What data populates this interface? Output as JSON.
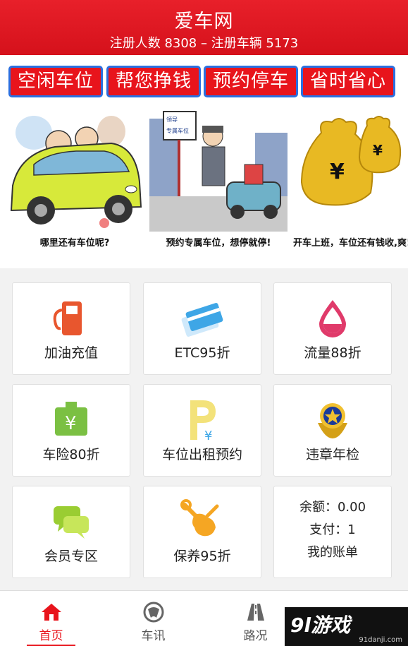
{
  "header": {
    "title": "爱车网",
    "stats": "注册人数 8308 – 注册车辆 5173"
  },
  "tags": [
    "空闲车位",
    "帮您挣钱",
    "预约停车",
    "省时省心"
  ],
  "banner": {
    "slides": [
      {
        "caption": "哪里还有车位呢?"
      },
      {
        "caption": "预约专属车位，想停就停!"
      },
      {
        "caption": "开车上班，车位还有钱收,爽!"
      }
    ],
    "sign_text_1": "领导",
    "sign_text_2": "专属车位"
  },
  "grid": {
    "tiles": [
      {
        "label": "加油充值",
        "icon": "fuel-pump-icon",
        "color": "#e8562e"
      },
      {
        "label": "ETC95折",
        "icon": "etc-card-icon",
        "color": "#3ea6e6"
      },
      {
        "label": "流量88折",
        "icon": "data-drop-icon",
        "color": "#e03a6a"
      },
      {
        "label": "车险80折",
        "icon": "insurance-bag-icon",
        "color": "#7bc043"
      },
      {
        "label": "车位出租预约",
        "icon": "parking-yen-icon",
        "color": "#f3e27a"
      },
      {
        "label": "违章年检",
        "icon": "police-badge-icon",
        "color": "#c43c2a"
      },
      {
        "label": "会员专区",
        "icon": "chat-bubbles-icon",
        "color": "#9acd32"
      },
      {
        "label": "保养95折",
        "icon": "wrench-icon",
        "color": "#f5a623"
      }
    ],
    "account": {
      "balance": "余额：0.00",
      "payment": "支付：1",
      "bill": "我的账单"
    }
  },
  "bottom_nav": {
    "items": [
      {
        "label": "首页",
        "icon": "home-icon"
      },
      {
        "label": "车讯",
        "icon": "news-icon"
      },
      {
        "label": "路况",
        "icon": "road-icon"
      }
    ]
  },
  "watermark": {
    "main": "9l游戏",
    "sub": "91danji.com"
  }
}
